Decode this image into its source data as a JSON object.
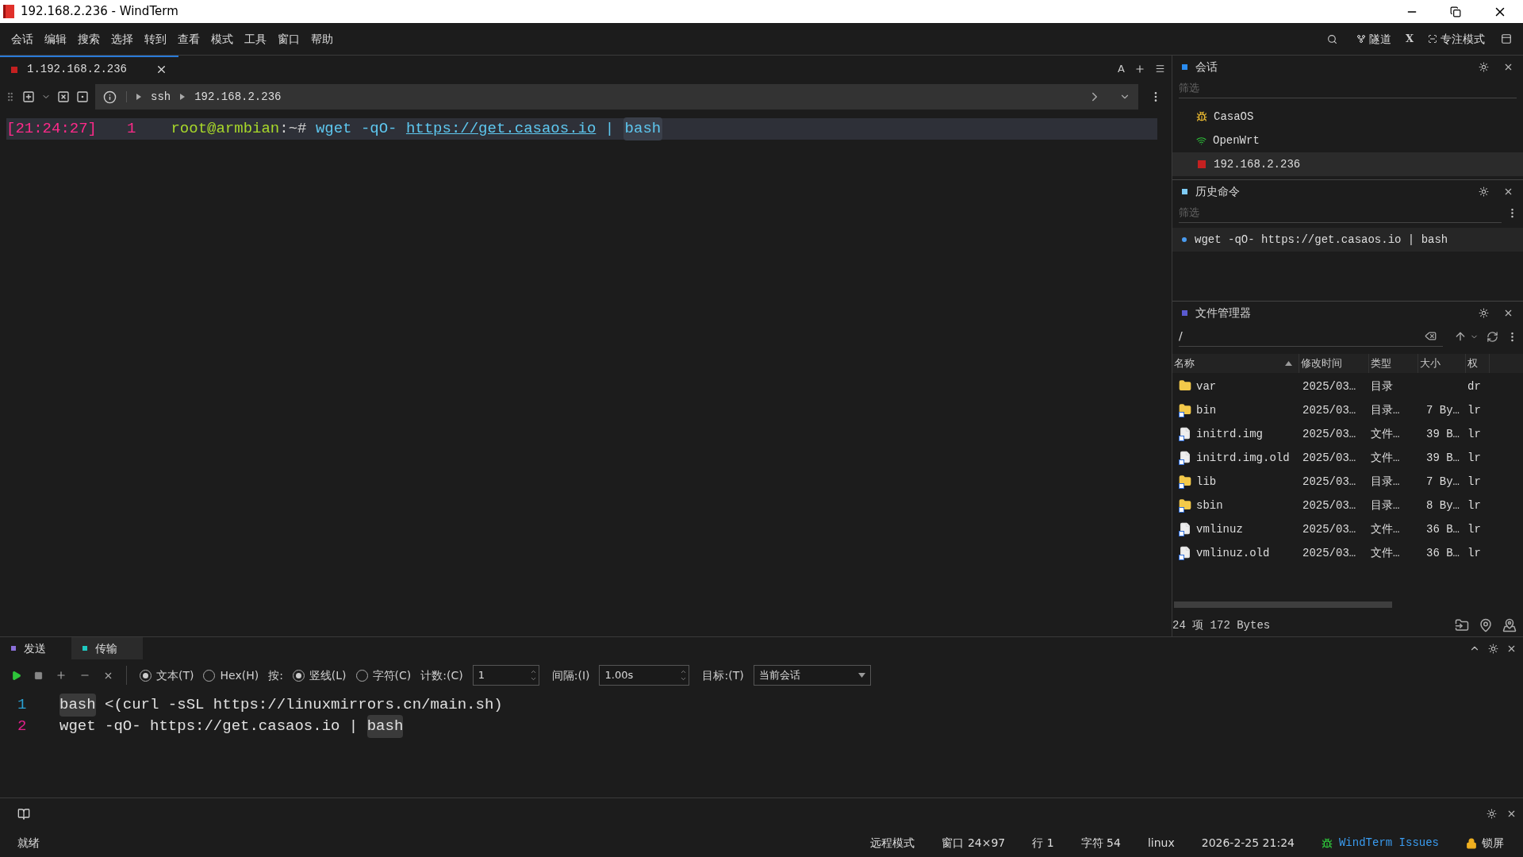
{
  "window": {
    "title": "192.168.2.236 - WindTerm"
  },
  "menu": [
    "会话",
    "编辑",
    "搜索",
    "选择",
    "转到",
    "查看",
    "模式",
    "工具",
    "窗口",
    "帮助"
  ],
  "menu_right": [
    {
      "kind": "search"
    },
    {
      "kind": "tunnel",
      "label": "隧道"
    },
    {
      "kind": "text",
      "label": "X"
    },
    {
      "kind": "focus",
      "label": "专注模式"
    },
    {
      "kind": "panel"
    }
  ],
  "tabs": [
    {
      "label": "1.192.168.2.236",
      "selected": true
    }
  ],
  "tab_font_button": "A",
  "breadcrumb": [
    "ssh",
    "192.168.2.236"
  ],
  "terminal": {
    "lines": [
      {
        "segments": [
          {
            "kind": "time",
            "text": "[21:24:27]"
          },
          {
            "kind": "number",
            "text": "1"
          },
          {
            "kind": "user",
            "text": "root@armbian"
          },
          {
            "kind": "path",
            "text": ":~#"
          },
          {
            "kind": "command",
            "text": " wget -qO- "
          },
          {
            "kind": "url",
            "text": "https://get.casaos.io"
          },
          {
            "kind": "command",
            "text": " | "
          },
          {
            "kind": "highlight",
            "text": "bash"
          }
        ]
      }
    ]
  },
  "sessions": {
    "title": "会话",
    "filter_placeholder": "筛选",
    "items": [
      {
        "name": "CasaOS",
        "kind": "linux",
        "selected": false
      },
      {
        "name": "OpenWrt",
        "kind": "wifi",
        "selected": false
      },
      {
        "name": "192.168.2.236",
        "kind": "active",
        "selected": true
      }
    ]
  },
  "history": {
    "title": "历史命令",
    "filter_placeholder": "筛选",
    "items": [
      "wget -qO- https://get.casaos.io | bash"
    ]
  },
  "files": {
    "title": "文件管理器",
    "path": "/",
    "columns": [
      "名称",
      "修改时间",
      "类型",
      "大小",
      "权"
    ],
    "rows": [
      {
        "kind": "folder",
        "name": "var",
        "modified": "2025/03…",
        "type": "目录",
        "size": "",
        "perm": "dr"
      },
      {
        "kind": "folder-link",
        "name": "bin",
        "modified": "2025/03…",
        "type": "目录…",
        "size": "7 By…",
        "perm": "lr"
      },
      {
        "kind": "file-link",
        "name": "initrd.img",
        "modified": "2025/03…",
        "type": "文件…",
        "size": "39 B…",
        "perm": "lr"
      },
      {
        "kind": "file-link",
        "name": "initrd.img.old",
        "modified": "2025/03…",
        "type": "文件…",
        "size": "39 B…",
        "perm": "lr"
      },
      {
        "kind": "folder-link",
        "name": "lib",
        "modified": "2025/03…",
        "type": "目录…",
        "size": "7 By…",
        "perm": "lr"
      },
      {
        "kind": "folder-link",
        "name": "sbin",
        "modified": "2025/03…",
        "type": "目录…",
        "size": "8 By…",
        "perm": "lr"
      },
      {
        "kind": "file-link",
        "name": "vmlinuz",
        "modified": "2025/03…",
        "type": "文件…",
        "size": "36 B…",
        "perm": "lr"
      },
      {
        "kind": "file-link",
        "name": "vmlinuz.old",
        "modified": "2025/03…",
        "type": "文件…",
        "size": "36 B…",
        "perm": "lr"
      }
    ],
    "footer": "24 项 172 Bytes"
  },
  "send": {
    "tabs": [
      {
        "label": "发送",
        "selected": false,
        "color": "#8a6fd8"
      },
      {
        "label": "传输",
        "selected": true,
        "color": "#1fc9c0"
      }
    ],
    "mode_options": [
      {
        "label": "文本(T)",
        "selected": true
      },
      {
        "label": "Hex(H)",
        "selected": false
      }
    ],
    "by_label": "按:",
    "by_options": [
      {
        "label": "竖线(L)",
        "selected": true
      },
      {
        "label": "字符(C)",
        "selected": false
      }
    ],
    "count": {
      "label": "计数:(C)",
      "value": "1"
    },
    "interval": {
      "label": "间隔:(I)",
      "value": "1.00s"
    },
    "target": {
      "label": "目标:(T)",
      "value": "当前会话"
    },
    "lines": [
      {
        "number": "1",
        "color": "#2aa1d3",
        "segments": [
          {
            "text": "bash",
            "highlighted": true
          },
          {
            "text": " <(curl -sSL https://linuxmirrors.cn/main.sh)",
            "highlighted": false
          }
        ]
      },
      {
        "number": "2",
        "color": "#e0208a",
        "segments": [
          {
            "text": "wget -qO- https://get.casaos.io | ",
            "highlighted": false
          },
          {
            "text": "bash",
            "highlighted": true
          }
        ]
      }
    ]
  },
  "status": {
    "ready": "就绪",
    "items": [
      "远程模式",
      "窗口 24×97",
      "行 1",
      "字符 54",
      "linux",
      "2026-2-25 21:24"
    ],
    "link": "WindTerm Issues",
    "lock": "锁屏"
  }
}
